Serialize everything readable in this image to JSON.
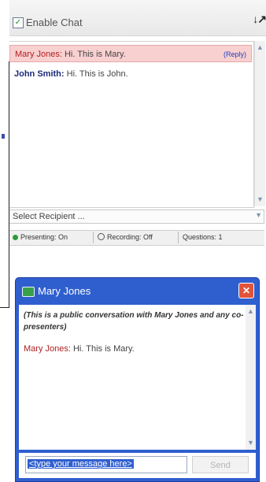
{
  "header": {
    "enable_chat_label": "Enable Chat",
    "arrows": "↓↗"
  },
  "messages": [
    {
      "sender": "Mary Jones:",
      "text": " Hi. This is Mary.",
      "action": "(Reply)"
    },
    {
      "sender": "John Smith:",
      "text": " Hi. This is John."
    }
  ],
  "recipient": {
    "label": "Select Recipient ..."
  },
  "status_bar": {
    "presenting": "Presenting: On",
    "recording": "Recording: Off",
    "questions": "Questions: 1"
  },
  "private_chat": {
    "title": "Mary Jones",
    "intro": "(This is a public conversation with Mary Jones and any co-presenters)",
    "message_sender": "Mary Jones:",
    "message_text": " Hi. This is Mary.",
    "input_value": "<type your message here>",
    "send_label": "Send"
  }
}
